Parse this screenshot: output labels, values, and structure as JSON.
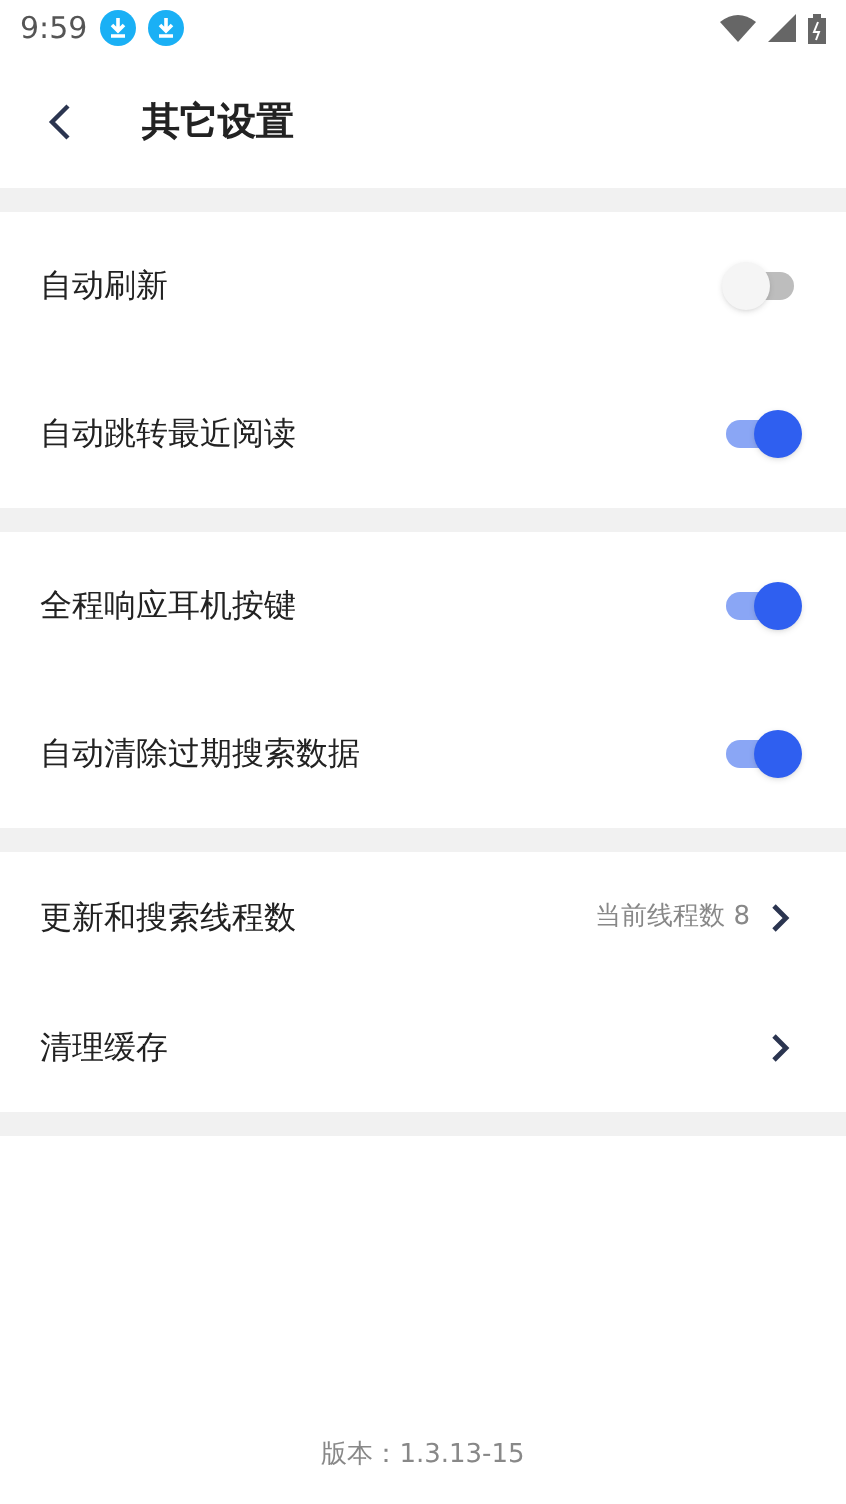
{
  "status_bar": {
    "time": "9:59"
  },
  "header": {
    "title": "其它设置"
  },
  "groups": [
    {
      "items": [
        {
          "kind": "toggle",
          "label": "自动刷新",
          "on": false
        },
        {
          "kind": "toggle",
          "label": "自动跳转最近阅读",
          "on": true
        }
      ]
    },
    {
      "items": [
        {
          "kind": "toggle",
          "label": "全程响应耳机按键",
          "on": true
        },
        {
          "kind": "toggle",
          "label": "自动清除过期搜索数据",
          "on": true
        }
      ]
    },
    {
      "items": [
        {
          "kind": "link",
          "label": "更新和搜索线程数",
          "value": "当前线程数 8"
        },
        {
          "kind": "link",
          "label": "清理缓存"
        }
      ]
    }
  ],
  "footer": {
    "version": "版本：1.3.13-15"
  }
}
